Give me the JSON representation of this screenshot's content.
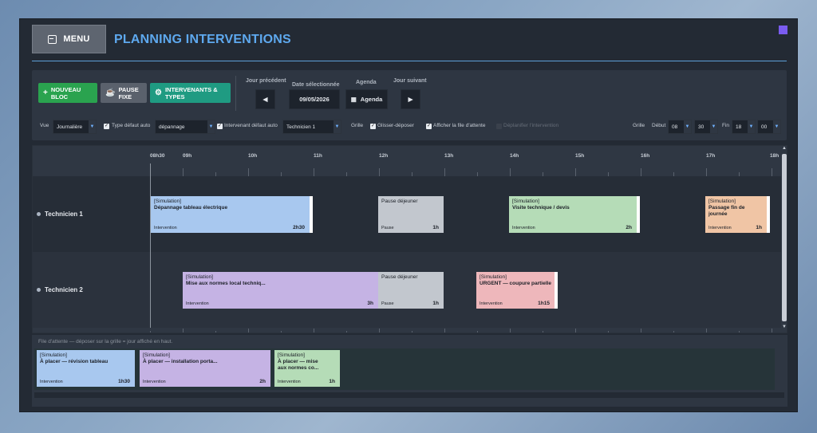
{
  "header": {
    "menu_label": "MENU",
    "title": "PLANNING INTERVENTIONS"
  },
  "toolbar": {
    "new_block": "NOUVEAU BLOC",
    "fixed_break": "PAUSE FIXE",
    "staff_types": "INTERVENANTS & TYPES",
    "prev_day_label": "Jour précédent",
    "prev_day_btn": "◀",
    "selected_date_label": "Date sélectionnée",
    "selected_date": "09/05/2026",
    "agenda_label": "Agenda",
    "agenda_btn": "Agenda",
    "next_day_label": "Jour suivant",
    "next_day_btn": "▶",
    "vue_label": "Vue",
    "vue_value": "Journalière",
    "type_default_label": "Type défaut auto",
    "type_value": "dépannage",
    "intervenant_default_label": "Intervenant défaut auto",
    "intervenant_value": "Technicien 1",
    "grille_label": "Grille",
    "drag_drop_label": "Glisser-déposer",
    "show_queue_label": "Afficher la file d'attente",
    "unschedule_label": "Déplanifier l'intervention",
    "grille_label_2": "Grille",
    "debut_label": "Début",
    "debut_hour": "08",
    "debut_min": "30",
    "fin_label": "Fin",
    "fin_hour": "18",
    "fin_min": "00"
  },
  "timeline": {
    "ticks": [
      "08h30",
      "09h",
      "10h",
      "11h",
      "12h",
      "13h",
      "14h",
      "15h",
      "16h",
      "17h",
      "18h"
    ]
  },
  "technicians": [
    {
      "name": "Technicien 1"
    },
    {
      "name": "Technicien 2"
    }
  ],
  "blocks": {
    "t1_b1": {
      "l1": "[Simulation]",
      "l2": "Dépannage tableau électrique",
      "cat": "Intervention",
      "dur": "2h30"
    },
    "t1_b2": {
      "l1": "Pause déjeuner",
      "l2": "",
      "cat": "Pause",
      "dur": "1h"
    },
    "t1_b3": {
      "l1": "[Simulation]",
      "l2": "Visite technique / devis",
      "cat": "Intervention",
      "dur": "2h"
    },
    "t1_b4": {
      "l1": "[Simulation]",
      "l2": "Passage fin de journée",
      "cat": "Intervention",
      "dur": "1h"
    },
    "t2_b1": {
      "l1": "[Simulation]",
      "l2": "Mise aux normes local techniq...",
      "cat": "Intervention",
      "dur": "3h"
    },
    "t2_b2": {
      "l1": "Pause déjeuner",
      "l2": "",
      "cat": "Pause",
      "dur": "1h"
    },
    "t2_b3": {
      "l1": "[Simulation]",
      "l2": "URGENT — coupure partielle",
      "cat": "Intervention",
      "dur": "1h15"
    }
  },
  "queue": {
    "label": "File d'attente — déposer sur la grille = jour affiché en haut.",
    "items": [
      {
        "l1": "[Simulation]",
        "l2": "À placer — révision tableau",
        "cat": "Intervention",
        "dur": "1h30"
      },
      {
        "l1": "[Simulation]",
        "l2": "À placer — installation porta...",
        "cat": "Intervention",
        "dur": "2h"
      },
      {
        "l1": "[Simulation]",
        "l2": "À placer — mise aux normes co...",
        "cat": "Intervention",
        "dur": "1h"
      }
    ]
  },
  "colors": {
    "accent": "#5ea9ef",
    "new_block": "#2aa34f",
    "staff_types": "#1f9b82",
    "pause": "#c2c7ce"
  }
}
